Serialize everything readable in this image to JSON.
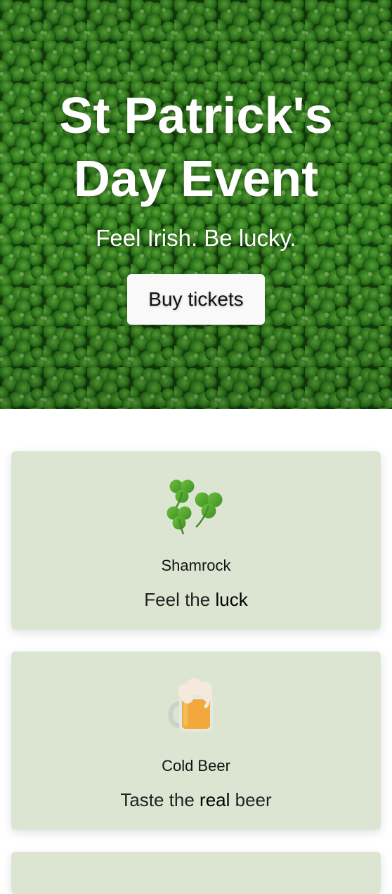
{
  "hero": {
    "title_line1": "St Patrick's",
    "title_line2": "Day Event",
    "tagline": "Feel Irish. Be lucky.",
    "button_label": "Buy tickets",
    "background_icon": "clover-pattern"
  },
  "features": [
    {
      "icon": "shamrock-icon",
      "title": "Shamrock",
      "text_before": "Feel the ",
      "text_emph": "luck",
      "text_after": ""
    },
    {
      "icon": "beer-mug-icon",
      "title": "Cold Beer",
      "text_before": "Taste the ",
      "text_emph": "real",
      "text_after": " beer"
    }
  ],
  "colors": {
    "hero_bg": "#1f5a14",
    "card_bg": "#dce5d2",
    "button_bg": "#f8f9f8"
  }
}
